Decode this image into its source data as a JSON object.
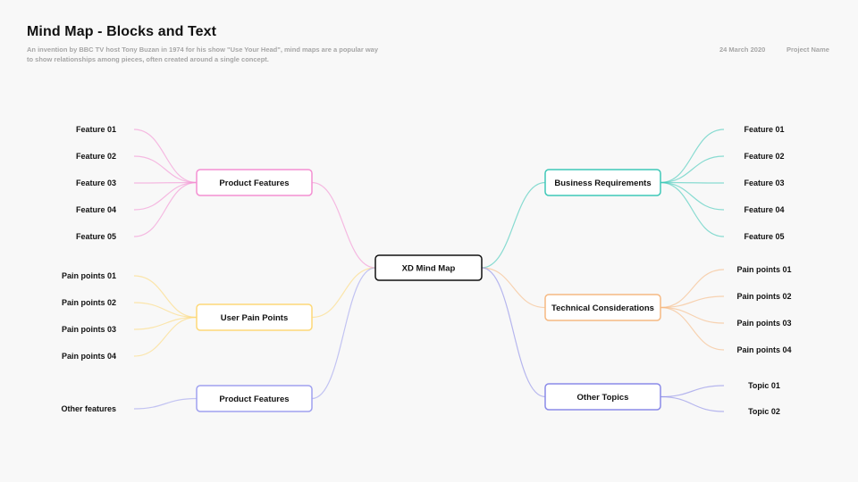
{
  "header": {
    "title": "Mind Map - Blocks and Text",
    "subtitle": "An invention by BBC TV host Tony Buzan in 1974 for his show \"Use Your Head\", mind maps are a popular way to show relationships among pieces, often created around a single concept.",
    "date": "24 March 2020",
    "project": "Project Name"
  },
  "center": {
    "label": "XD Mind Map",
    "color": "#111111"
  },
  "branches": [
    {
      "id": "product-features",
      "side": "left",
      "label": "Product Features",
      "color": "#f48fd2",
      "leaves": [
        "Feature 01",
        "Feature 02",
        "Feature 03",
        "Feature 04",
        "Feature 05"
      ]
    },
    {
      "id": "user-pain-points",
      "side": "left",
      "label": "User Pain Points",
      "color": "#fdd878",
      "leaves": [
        "Pain points 01",
        "Pain points 02",
        "Pain points 03",
        "Pain points 04"
      ]
    },
    {
      "id": "product-features-2",
      "side": "left",
      "label": "Product Features",
      "color": "#9fa0ef",
      "leaves": [
        "Other features"
      ]
    },
    {
      "id": "business-requirements",
      "side": "right",
      "label": "Business Requirements",
      "color": "#3ec8b8",
      "leaves": [
        "Feature 01",
        "Feature 02",
        "Feature 03",
        "Feature 04",
        "Feature 05"
      ]
    },
    {
      "id": "technical-considerations",
      "side": "right",
      "label": "Technical Considerations",
      "color": "#f6b982",
      "leaves": [
        "Pain points 01",
        "Pain points 02",
        "Pain points 03",
        "Pain points 04"
      ]
    },
    {
      "id": "other-topics",
      "side": "right",
      "label": "Other Topics",
      "color": "#8a8ae8",
      "leaves": [
        "Topic 01",
        "Topic 02"
      ]
    }
  ]
}
